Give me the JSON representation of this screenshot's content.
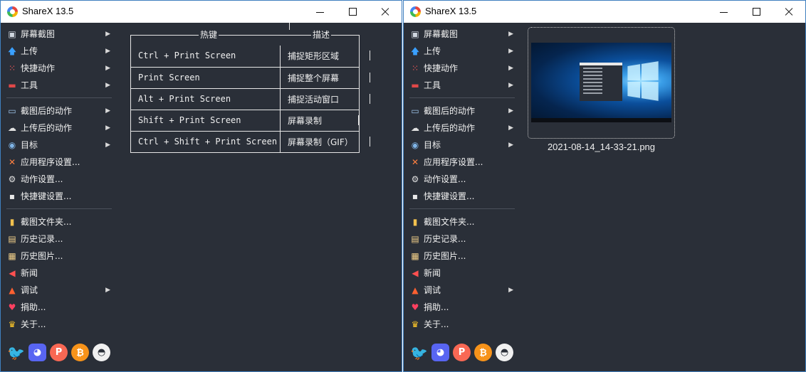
{
  "app": {
    "title": "ShareX 13.5"
  },
  "menu": [
    {
      "label": "屏幕截图",
      "icon": "monitor-icon",
      "submenu": true
    },
    {
      "label": "上传",
      "icon": "upload-arrow-icon",
      "submenu": true
    },
    {
      "label": "快捷动作",
      "icon": "grid-dots-icon",
      "submenu": true
    },
    {
      "label": "工具",
      "icon": "toolbox-icon",
      "submenu": true
    },
    {
      "sep": true
    },
    {
      "label": "截图后的动作",
      "icon": "image-task-icon",
      "submenu": true
    },
    {
      "label": "上传后的动作",
      "icon": "cloud-icon",
      "submenu": true
    },
    {
      "label": "目标",
      "icon": "destination-icon",
      "submenu": true
    },
    {
      "label": "应用程序设置...",
      "icon": "wrench-icon",
      "submenu": false
    },
    {
      "label": "动作设置...",
      "icon": "gear-icon",
      "submenu": false
    },
    {
      "label": "快捷键设置...",
      "icon": "keyboard-icon",
      "submenu": false
    },
    {
      "sep": true
    },
    {
      "label": "截图文件夹...",
      "icon": "folder-icon",
      "submenu": false
    },
    {
      "label": "历史记录...",
      "icon": "history-icon",
      "submenu": false
    },
    {
      "label": "历史图片...",
      "icon": "image-history-icon",
      "submenu": false
    },
    {
      "label": "新闻",
      "icon": "megaphone-icon",
      "submenu": false
    },
    {
      "label": "调试",
      "icon": "traffic-cone-icon",
      "submenu": true
    },
    {
      "label": "捐助...",
      "icon": "heart-icon",
      "submenu": false
    },
    {
      "label": "关于...",
      "icon": "crown-icon",
      "submenu": false
    }
  ],
  "social": [
    {
      "name": "twitter",
      "glyph": "🐦"
    },
    {
      "name": "discord",
      "glyph": "◕"
    },
    {
      "name": "patreon",
      "glyph": "P"
    },
    {
      "name": "bitcoin",
      "glyph": "₿"
    },
    {
      "name": "github",
      "glyph": "◓"
    }
  ],
  "hotkeys": {
    "col_key": "热键",
    "col_desc": "描述",
    "rows": [
      {
        "key": "Ctrl + Print Screen",
        "desc": "捕捉矩形区域"
      },
      {
        "key": "Print Screen",
        "desc": "捕捉整个屏幕"
      },
      {
        "key": "Alt + Print Screen",
        "desc": "捕捉活动窗口"
      },
      {
        "key": "Shift + Print Screen",
        "desc": "屏幕录制"
      },
      {
        "key": "Ctrl + Shift + Print Screen",
        "desc": "屏幕录制（GIF）"
      }
    ]
  },
  "thumbnail": {
    "filename": "2021-08-14_14-33-21.png"
  },
  "colors": {
    "client_bg": "#2a2f38",
    "text": "#f0f0f0",
    "border": "#3f7fbf"
  }
}
